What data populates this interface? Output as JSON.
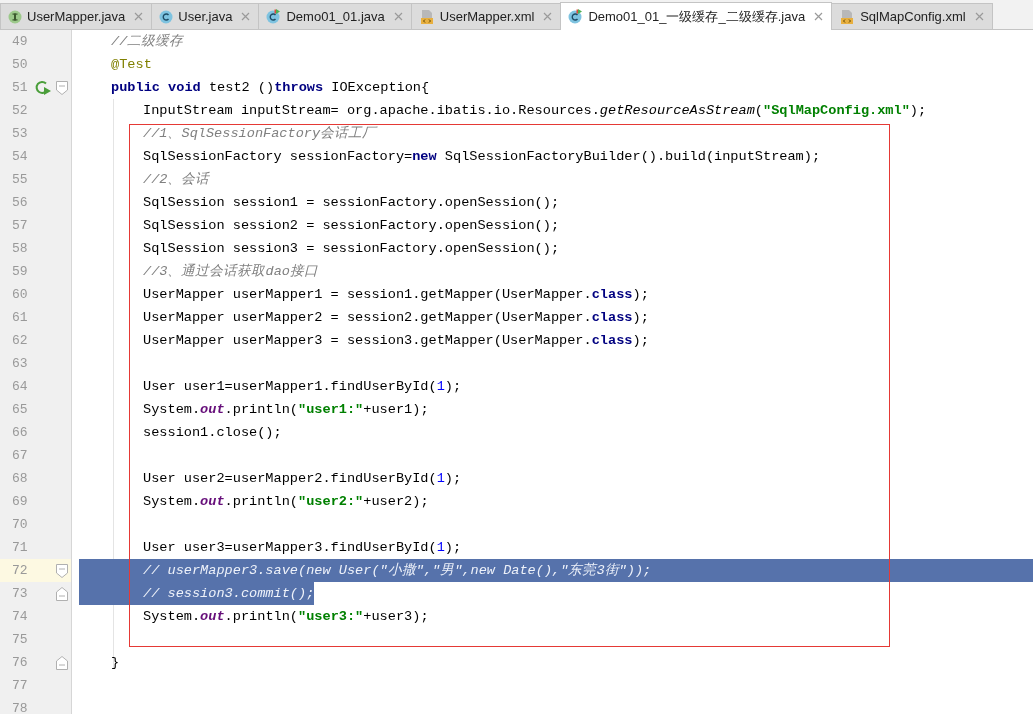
{
  "tabs": [
    {
      "label": "UserMapper.java",
      "kind": "interface",
      "selected": false
    },
    {
      "label": "User.java",
      "kind": "class",
      "selected": false
    },
    {
      "label": "Demo01_01.java",
      "kind": "class-runnable",
      "selected": false
    },
    {
      "label": "UserMapper.xml",
      "kind": "xml",
      "selected": false
    },
    {
      "label": "Demo01_01_一级缓存_二级缓存.java",
      "kind": "class-runnable",
      "selected": true
    },
    {
      "label": "SqlMapConfig.xml",
      "kind": "xml",
      "selected": false
    }
  ],
  "editor": {
    "blocks": [
      {
        "framed": false,
        "lines": [
          {
            "number": "49",
            "selected": false,
            "current": false,
            "tokens": [
              {
                "kind": "comment",
                "text": "//二级缓存"
              }
            ]
          },
          {
            "number": "50",
            "selected": false,
            "current": false,
            "tokens": [
              {
                "kind": "annotation",
                "text": "@Test"
              }
            ]
          },
          {
            "number": "51",
            "selected": false,
            "current": false,
            "gutter_icons": [
              {
                "kind": "run"
              },
              {
                "kind": "fold-start"
              }
            ],
            "tokens": [
              {
                "kind": "keyword",
                "text": "public"
              },
              {
                "kind": "keyword",
                "text": " void"
              },
              {
                "kind": "plain",
                "text": " test2 ()"
              },
              {
                "kind": "keyword",
                "text": "throws"
              },
              {
                "kind": "plain",
                "text": " IOException{"
              }
            ]
          },
          {
            "number": "52",
            "selected": false,
            "current": false,
            "tokens": [
              {
                "kind": "plain",
                "text": "InputStream inputStream= org.apache.ibatis.io.Resources."
              },
              {
                "kind": "static-method",
                "text": "getResourceAsStream"
              },
              {
                "kind": "plain",
                "text": "("
              },
              {
                "kind": "string",
                "text": "\"SqlMapConfig.xml\""
              },
              {
                "kind": "plain",
                "text": ");"
              }
            ]
          }
        ]
      },
      {
        "framed": true,
        "lines": [
          {
            "number": "53",
            "selected": false,
            "current": false,
            "tokens": [
              {
                "kind": "comment",
                "text": "//1、SqlSessionFactory会话工厂"
              }
            ]
          },
          {
            "number": "54",
            "selected": false,
            "current": false,
            "tokens": [
              {
                "kind": "plain",
                "text": "SqlSessionFactory sessionFactory="
              },
              {
                "kind": "keyword",
                "text": "new"
              },
              {
                "kind": "plain",
                "text": " SqlSessionFactoryBuilder().build(inputStream);"
              }
            ]
          },
          {
            "number": "55",
            "selected": false,
            "current": false,
            "tokens": [
              {
                "kind": "comment",
                "text": "//2、会话"
              }
            ]
          },
          {
            "number": "56",
            "selected": false,
            "current": false,
            "tokens": [
              {
                "kind": "plain",
                "text": "SqlSession session1 = sessionFactory.openSession();"
              }
            ]
          },
          {
            "number": "57",
            "selected": false,
            "current": false,
            "tokens": [
              {
                "kind": "plain",
                "text": "SqlSession session2 = sessionFactory.openSession();"
              }
            ]
          },
          {
            "number": "58",
            "selected": false,
            "current": false,
            "tokens": [
              {
                "kind": "plain",
                "text": "SqlSession session3 = sessionFactory.openSession();"
              }
            ]
          },
          {
            "number": "59",
            "selected": false,
            "current": false,
            "tokens": [
              {
                "kind": "comment",
                "text": "//3、通过会话获取dao接口"
              }
            ]
          },
          {
            "number": "60",
            "selected": false,
            "current": false,
            "tokens": [
              {
                "kind": "plain",
                "text": "UserMapper userMapper1 = session1.getMapper(UserMapper."
              },
              {
                "kind": "keyword",
                "text": "class"
              },
              {
                "kind": "plain",
                "text": ");"
              }
            ]
          },
          {
            "number": "61",
            "selected": false,
            "current": false,
            "tokens": [
              {
                "kind": "plain",
                "text": "UserMapper userMapper2 = session2.getMapper(UserMapper."
              },
              {
                "kind": "keyword",
                "text": "class"
              },
              {
                "kind": "plain",
                "text": ");"
              }
            ]
          },
          {
            "number": "62",
            "selected": false,
            "current": false,
            "tokens": [
              {
                "kind": "plain",
                "text": "UserMapper userMapper3 = session3.getMapper(UserMapper."
              },
              {
                "kind": "keyword",
                "text": "class"
              },
              {
                "kind": "plain",
                "text": ");"
              }
            ]
          },
          {
            "number": "63",
            "selected": false,
            "current": false
          },
          {
            "number": "64",
            "selected": false,
            "current": false,
            "tokens": [
              {
                "kind": "plain",
                "text": "User user1=userMapper1.findUserById("
              },
              {
                "kind": "number",
                "text": "1"
              },
              {
                "kind": "plain",
                "text": ");"
              }
            ]
          },
          {
            "number": "65",
            "selected": false,
            "current": false,
            "tokens": [
              {
                "kind": "plain",
                "text": "System."
              },
              {
                "kind": "static-field",
                "text": "out"
              },
              {
                "kind": "plain",
                "text": ".println("
              },
              {
                "kind": "string",
                "text": "\"user1:\""
              },
              {
                "kind": "plain",
                "text": "+user1);"
              }
            ]
          },
          {
            "number": "66",
            "selected": false,
            "current": false,
            "tokens": [
              {
                "kind": "plain",
                "text": "session1.close();"
              }
            ]
          },
          {
            "number": "67",
            "selected": false,
            "current": false
          },
          {
            "number": "68",
            "selected": false,
            "current": false,
            "tokens": [
              {
                "kind": "plain",
                "text": "User user2=userMapper2.findUserById("
              },
              {
                "kind": "number",
                "text": "1"
              },
              {
                "kind": "plain",
                "text": ");"
              }
            ]
          },
          {
            "number": "69",
            "selected": false,
            "current": false,
            "tokens": [
              {
                "kind": "plain",
                "text": "System."
              },
              {
                "kind": "static-field",
                "text": "out"
              },
              {
                "kind": "plain",
                "text": ".println("
              },
              {
                "kind": "string",
                "text": "\"user2:\""
              },
              {
                "kind": "plain",
                "text": "+user2);"
              }
            ]
          },
          {
            "number": "70",
            "selected": false,
            "current": false
          },
          {
            "number": "71",
            "selected": false,
            "current": false,
            "tokens": [
              {
                "kind": "plain",
                "text": "User user3=userMapper3.findUserById("
              },
              {
                "kind": "number",
                "text": "1"
              },
              {
                "kind": "plain",
                "text": ");"
              }
            ]
          },
          {
            "number": "72",
            "selected": true,
            "current": true,
            "gutter_icons": [
              {
                "kind": "fold-start"
              }
            ],
            "tokens": [
              {
                "kind": "comment",
                "text": "// userMapper3.save(new User(\"小撒\",\"男\",new Date(),\"东莞3街\"));"
              }
            ]
          },
          {
            "number": "73",
            "selected": true,
            "current": false,
            "gutter_icons": [
              {
                "kind": "fold-end"
              }
            ],
            "tokens": [
              {
                "kind": "comment",
                "text": "// session3.commit();"
              }
            ]
          },
          {
            "number": "74",
            "selected": false,
            "current": false,
            "tokens": [
              {
                "kind": "plain",
                "text": "System."
              },
              {
                "kind": "static-field",
                "text": "out"
              },
              {
                "kind": "plain",
                "text": ".println("
              },
              {
                "kind": "string",
                "text": "\"user3:\""
              },
              {
                "kind": "plain",
                "text": "+user3);"
              }
            ]
          },
          {
            "number": "75",
            "selected": false,
            "current": false
          }
        ]
      },
      {
        "framed": false,
        "lines": [
          {
            "number": "76",
            "selected": false,
            "current": false,
            "gutter_icons": [
              {
                "kind": "fold-end"
              }
            ],
            "tokens": [
              {
                "kind": "plain",
                "text": "}"
              }
            ]
          },
          {
            "number": "77",
            "selected": false,
            "current": false
          },
          {
            "number": "78",
            "selected": false,
            "current": false
          }
        ]
      }
    ]
  }
}
